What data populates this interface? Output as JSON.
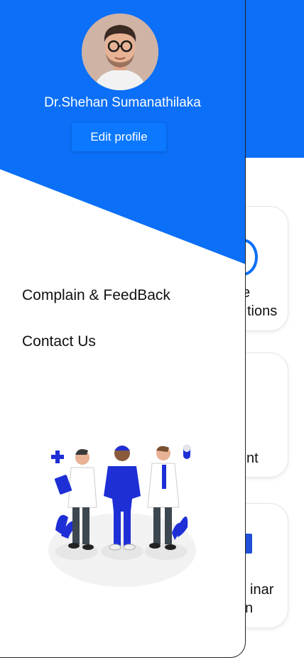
{
  "profile": {
    "name": "Dr.Shehan Sumanathilaka",
    "edit_label": "Edit profile"
  },
  "menu": {
    "items": [
      {
        "label": "Complain & FeedBack"
      },
      {
        "label": "Contact Us"
      }
    ]
  },
  "background_cards": [
    {
      "line1": "e",
      "line2": "tions"
    },
    {
      "line1": "nt"
    },
    {
      "line1": "inar",
      "line2": "n"
    }
  ],
  "colors": {
    "primary": "#0b6ff7",
    "button": "#0b78ff",
    "accent_scrubs": "#1e2fd6"
  }
}
